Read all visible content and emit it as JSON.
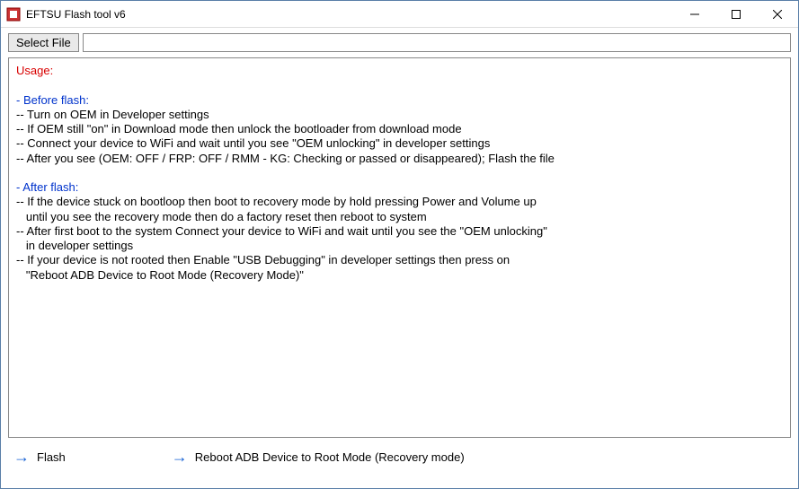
{
  "window": {
    "title": "EFTSU Flash tool v6"
  },
  "toolbar": {
    "select_label": "Select File",
    "file_value": ""
  },
  "usage": {
    "heading": "Usage:",
    "before": {
      "heading": "- Before flash:",
      "lines": [
        "-- Turn on OEM in Developer settings",
        "-- If OEM still \"on\" in Download mode then unlock the bootloader from download mode",
        "-- Connect your device to WiFi and wait until you see \"OEM unlocking\" in developer settings",
        "-- After you see (OEM: OFF / FRP: OFF / RMM - KG: Checking or passed or disappeared); Flash the file"
      ]
    },
    "after": {
      "heading": "- After flash:",
      "lines": [
        "-- If the device stuck on bootloop then boot to recovery mode by hold pressing Power and Volume up",
        "   until you see the recovery mode then do a factory reset then reboot to system",
        "-- After first boot to the system Connect your device to WiFi and wait until you see the \"OEM unlocking\"",
        "   in developer settings",
        "-- If your device is not rooted then Enable \"USB Debugging\" in developer settings then press on",
        "   \"Reboot ADB Device to Root Mode (Recovery Mode)\""
      ]
    }
  },
  "actions": {
    "flash": "Flash",
    "reboot": "Reboot ADB Device to Root Mode (Recovery mode)"
  }
}
